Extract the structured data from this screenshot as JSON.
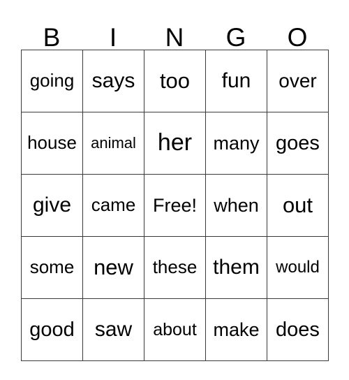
{
  "card": {
    "title_letters": [
      "B",
      "I",
      "N",
      "G",
      "O"
    ],
    "columns": 5,
    "rows": 5,
    "free_space": "Free!",
    "colors": {
      "background": "#ffffff",
      "grid_line": "#3a3a3a",
      "text": "#000000"
    },
    "grid": [
      [
        {
          "word": "going",
          "size": "fs-26"
        },
        {
          "word": "says",
          "size": "fs-30"
        },
        {
          "word": "too",
          "size": "fs-31"
        },
        {
          "word": "fun",
          "size": "fs-30"
        },
        {
          "word": "over",
          "size": "fs-28"
        }
      ],
      [
        {
          "word": "house",
          "size": "fs-26"
        },
        {
          "word": "animal",
          "size": "fs-22"
        },
        {
          "word": "her",
          "size": "fs-34"
        },
        {
          "word": "many",
          "size": "fs-27"
        },
        {
          "word": "goes",
          "size": "fs-29"
        }
      ],
      [
        {
          "word": "give",
          "size": "fs-30"
        },
        {
          "word": "came",
          "size": "fs-26"
        },
        {
          "word": "Free!",
          "size": "fs-27"
        },
        {
          "word": "when",
          "size": "fs-27"
        },
        {
          "word": "out",
          "size": "fs-31"
        }
      ],
      [
        {
          "word": "some",
          "size": "fs-26"
        },
        {
          "word": "new",
          "size": "fs-31"
        },
        {
          "word": "these",
          "size": "fs-26"
        },
        {
          "word": "them",
          "size": "fs-30"
        },
        {
          "word": "would",
          "size": "fs-24"
        }
      ],
      [
        {
          "word": "good",
          "size": "fs-29"
        },
        {
          "word": "saw",
          "size": "fs-30"
        },
        {
          "word": "about",
          "size": "fs-25"
        },
        {
          "word": "make",
          "size": "fs-27"
        },
        {
          "word": "does",
          "size": "fs-29"
        }
      ]
    ]
  }
}
